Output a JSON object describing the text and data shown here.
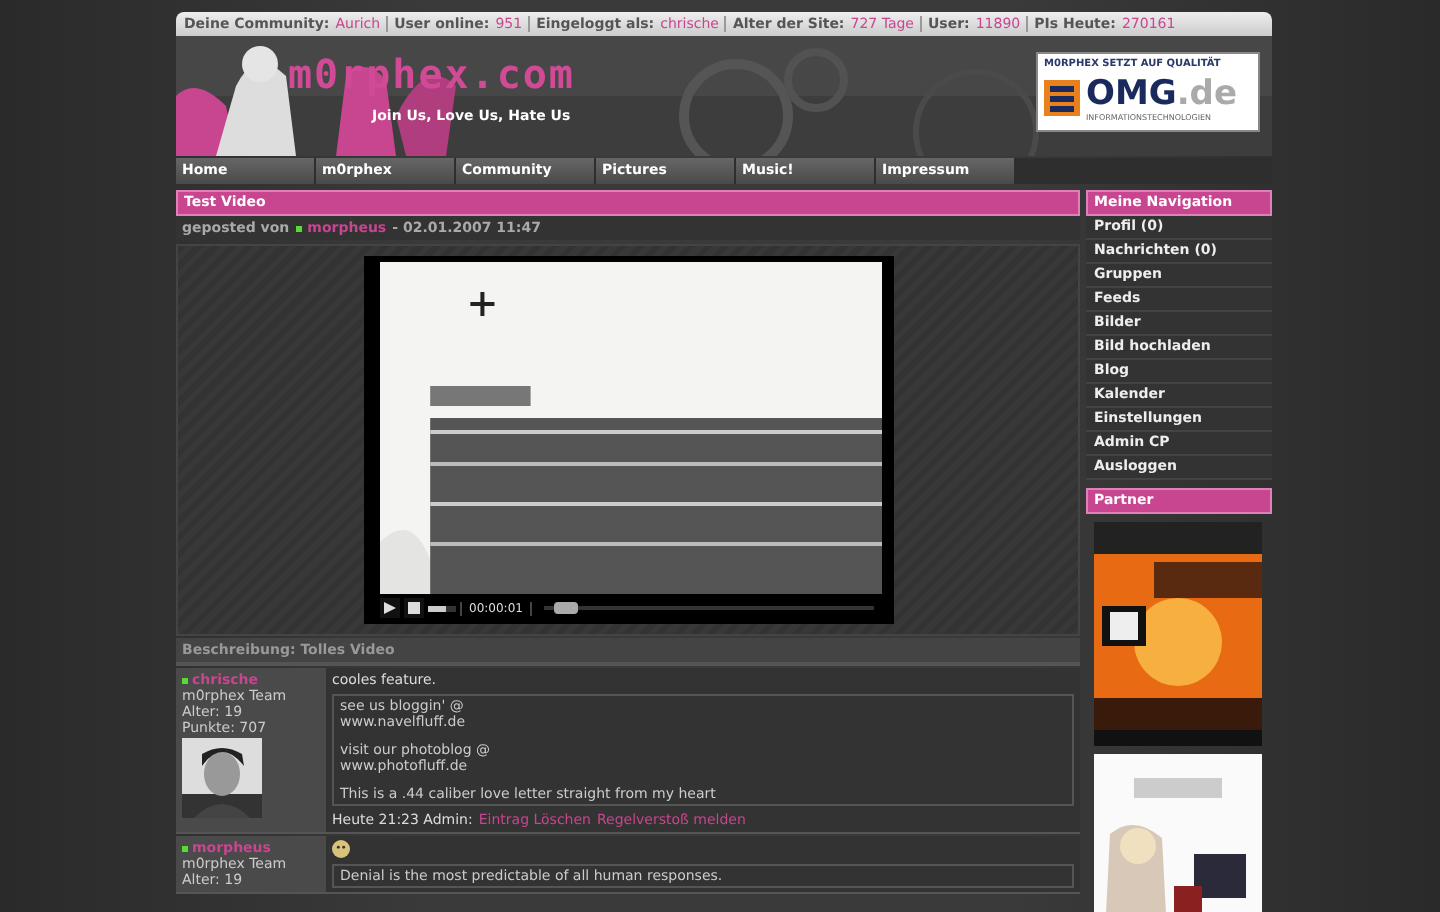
{
  "top_bar": [
    {
      "label": "Deine Community:",
      "value": "Aurich"
    },
    {
      "label": "User online:",
      "value": "951"
    },
    {
      "label": "Eingeloggt als:",
      "value": "chrische"
    },
    {
      "label": "Alter der Site:",
      "value": "727 Tage"
    },
    {
      "label": "User:",
      "value": "11890"
    },
    {
      "label": "PIs Heute:",
      "value": "270161"
    }
  ],
  "header": {
    "logo": "m0rphex.com",
    "tagline": "Join Us, Love Us, Hate Us",
    "ad": {
      "caption": "M0RPHEX SETZT AUF QUALITÄT",
      "brand": "OMG",
      "tld": ".de",
      "subtitle": "INFORMATIONSTECHNOLOGIEN"
    }
  },
  "nav": [
    "Home",
    "m0rphex",
    "Community",
    "Pictures",
    "Music!",
    "Impressum"
  ],
  "video": {
    "title": "Test Video",
    "posted_prefix": "geposted von",
    "author": "morpheus",
    "author_online": true,
    "date": "- 02.01.2007 11:47",
    "player": {
      "playing": false,
      "time": "00:00:01",
      "seek": {
        "level": 0.03
      },
      "volume": {
        "level": 0.7
      }
    },
    "description": "Beschreibung: Tolles Video"
  },
  "comments": [
    {
      "author": "chrische",
      "online": true,
      "rank": "m0rphex Team",
      "age": "Alter: 19",
      "points": "Punkte: 707",
      "avatar": {
        "kind": "picture"
      },
      "text": "cooles feature.",
      "signature": [
        [
          "see us bloggin' @",
          "www.navelfluff.de"
        ],
        [
          "visit our photoblog @",
          "www.photofluff.de"
        ],
        [
          "This is a .44 caliber love letter straight from my heart"
        ]
      ],
      "footer": "Heute 21:23 Admin:",
      "links": [
        "Eintrag Löschen",
        "Regelverstoß melden"
      ]
    },
    {
      "author": "morpheus",
      "online": true,
      "rank": "m0rphex Team",
      "age": "Alter: 19",
      "emoticon": true,
      "signature": [
        [
          "Denial is the most predictable of all human responses."
        ]
      ]
    }
  ],
  "sidebar": {
    "title": "Meine Navigation",
    "items": [
      "Profil (0)",
      "Nachrichten (0)",
      "Gruppen",
      "Feeds",
      "Bilder",
      "Bild hochladen",
      "Blog",
      "Kalender",
      "Einstellungen",
      "Admin CP",
      "Ausloggen"
    ]
  },
  "partner": {
    "title": "Partner",
    "banners": [
      {
        "kind": "picture"
      },
      {
        "kind": "picture"
      }
    ]
  }
}
